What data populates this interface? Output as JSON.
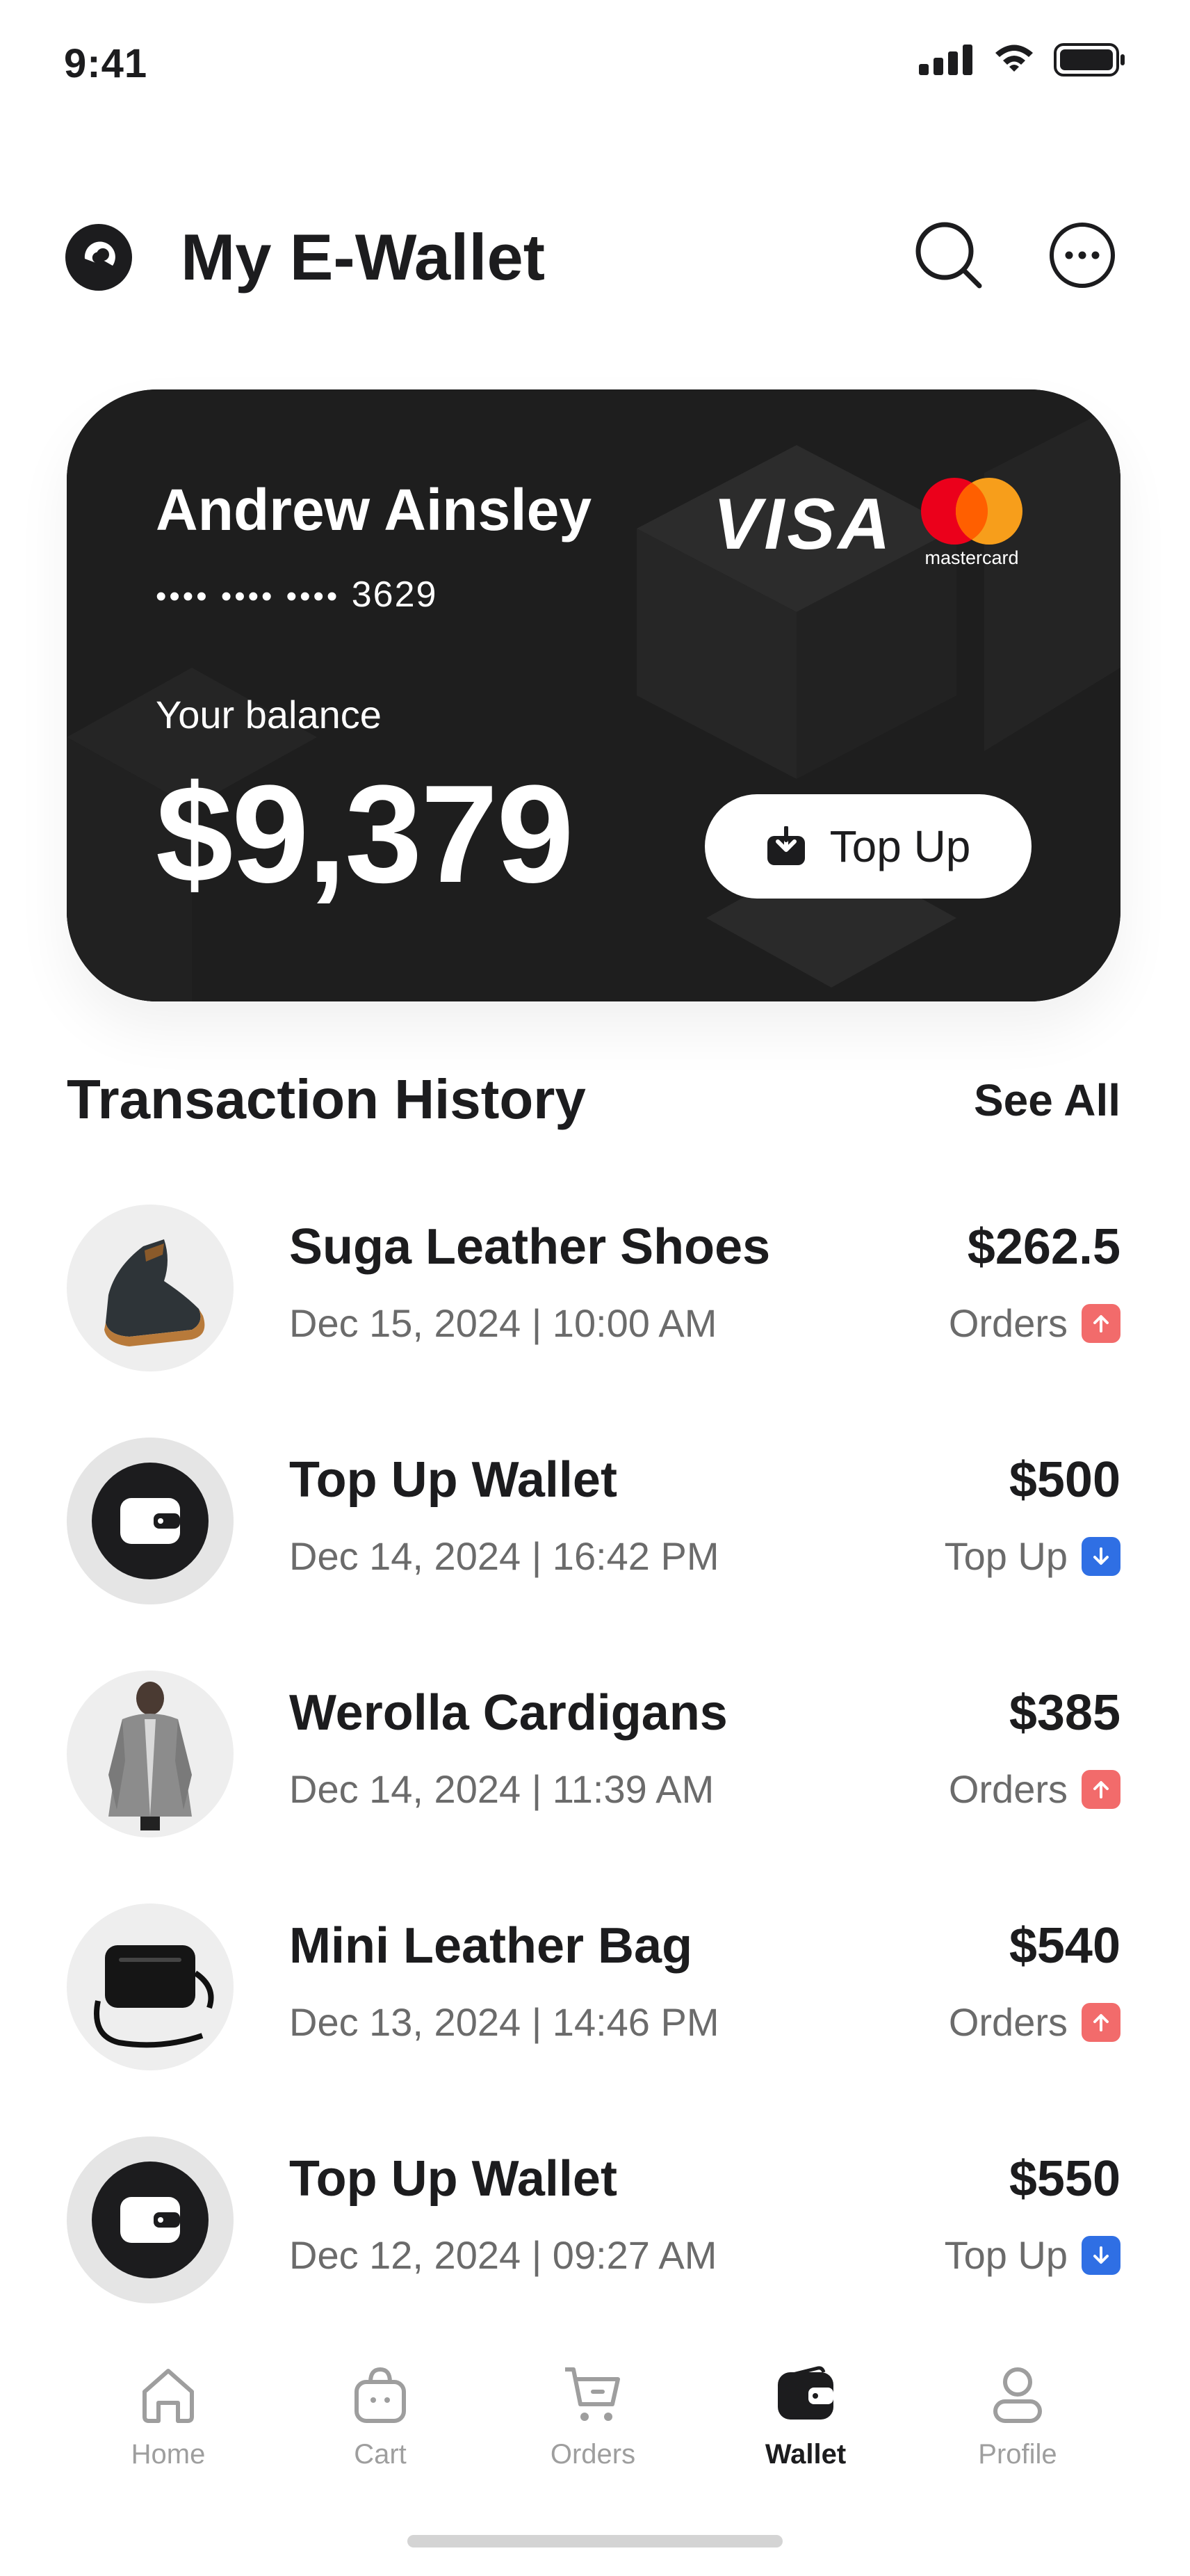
{
  "status_bar": {
    "time": "9:41"
  },
  "header": {
    "title": "My E-Wallet",
    "logo_icon": "e-wallet-logo-icon",
    "search_icon": "search-icon",
    "more_icon": "more-options-icon"
  },
  "card": {
    "holder": "Andrew Ainsley",
    "number_mask": "•••• •••• ••••",
    "number_last4": "3629",
    "balance_label": "Your balance",
    "balance": "$9,379",
    "visa": "VISA",
    "mastercard": "mastercard",
    "topup_label": "Top Up"
  },
  "transactions_section": {
    "title": "Transaction History",
    "see_all": "See All"
  },
  "transactions": [
    {
      "name": "Suga Leather Shoes",
      "date": "Dec 15, 2024 | 10:00 AM",
      "amount": "$262.5",
      "type": "Orders",
      "direction": "up",
      "icon": "shoe-icon"
    },
    {
      "name": "Top Up Wallet",
      "date": "Dec 14, 2024 | 16:42 PM",
      "amount": "$500",
      "type": "Top Up",
      "direction": "down",
      "icon": "wallet-icon"
    },
    {
      "name": "Werolla Cardigans",
      "date": "Dec 14, 2024 | 11:39 AM",
      "amount": "$385",
      "type": "Orders",
      "direction": "up",
      "icon": "cardigan-icon"
    },
    {
      "name": "Mini Leather Bag",
      "date": "Dec 13, 2024 | 14:46 PM",
      "amount": "$540",
      "type": "Orders",
      "direction": "up",
      "icon": "bag-icon"
    },
    {
      "name": "Top Up Wallet",
      "date": "Dec 12, 2024 | 09:27 AM",
      "amount": "$550",
      "type": "Top Up",
      "direction": "down",
      "icon": "wallet-icon"
    }
  ],
  "bottom_nav": [
    {
      "label": "Home",
      "icon": "home-icon",
      "active": false
    },
    {
      "label": "Cart",
      "icon": "cart-bag-icon",
      "active": false
    },
    {
      "label": "Orders",
      "icon": "orders-cart-icon",
      "active": false
    },
    {
      "label": "Wallet",
      "icon": "wallet-icon",
      "active": true
    },
    {
      "label": "Profile",
      "icon": "profile-icon",
      "active": false
    }
  ],
  "colors": {
    "primary": "#1c1c1e",
    "orders_badge": "#f26b6b",
    "topup_badge": "#2f6fe4",
    "mastercard_red": "#eb001b",
    "mastercard_orange": "#f79e1b"
  }
}
